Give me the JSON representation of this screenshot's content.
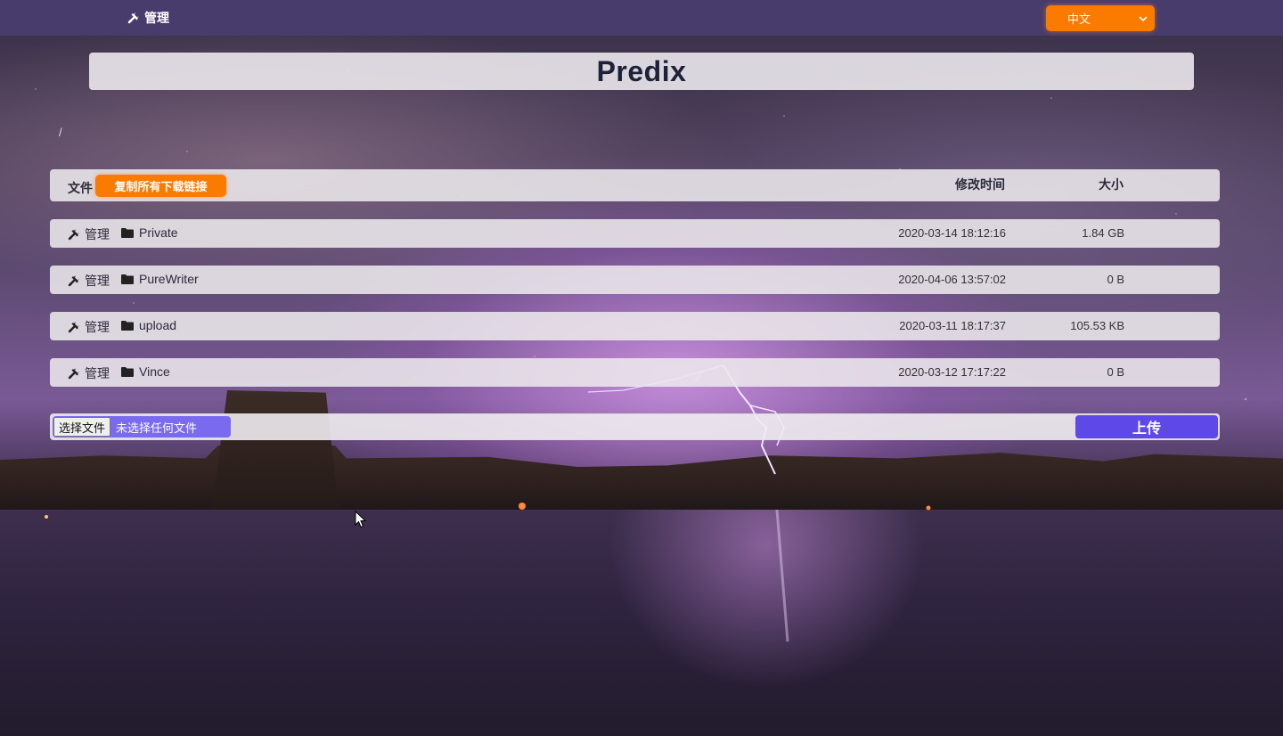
{
  "topbar": {
    "admin_label": "管理",
    "admin_icon": "tools-icon",
    "language_selected": "中文",
    "accent_color": "#fb7a00",
    "bar_color": "#473c6c"
  },
  "site": {
    "title": "Predix",
    "breadcrumb": "/"
  },
  "table": {
    "headers": {
      "file": "文件",
      "copy_links_button": "复制所有下载链接",
      "modified": "修改时间",
      "size": "大小"
    },
    "rows": [
      {
        "manage": "管理",
        "name": "Private",
        "modified": "2020-03-14 18:12:16",
        "size": "1.84 GB",
        "type_icon": "folder-icon"
      },
      {
        "manage": "管理",
        "name": "PureWriter",
        "modified": "2020-04-06 13:57:02",
        "size": "0 B",
        "type_icon": "folder-icon"
      },
      {
        "manage": "管理",
        "name": "upload",
        "modified": "2020-03-11 18:17:37",
        "size": "105.53 KB",
        "type_icon": "folder-icon"
      },
      {
        "manage": "管理",
        "name": "Vince",
        "modified": "2020-03-12 17:17:22",
        "size": "0 B",
        "type_icon": "folder-icon"
      }
    ]
  },
  "upload": {
    "choose_file_label": "选择文件",
    "no_file_text": "未选择任何文件",
    "upload_button": "上传",
    "upload_color": "#5f48e8"
  }
}
